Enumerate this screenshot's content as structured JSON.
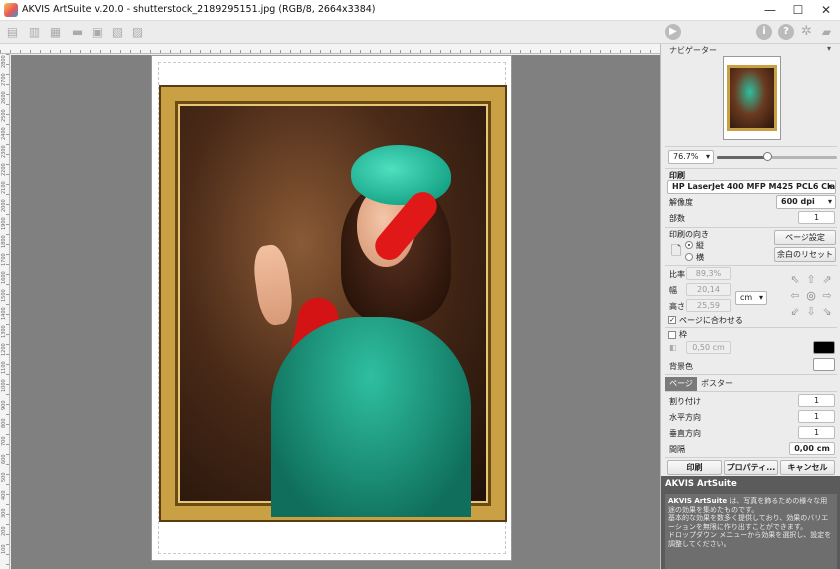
{
  "window": {
    "title": "AKVIS ArtSuite v.20.0 - shutterstock_2189295151.jpg (RGB/8, 2664x3384)",
    "minimize": "—",
    "maximize": "☐",
    "close": "✕"
  },
  "toolbar": {
    "left_icons": [
      "open-icon",
      "save-icon",
      "export-icon",
      "print-icon",
      "batch-icon",
      "preview-icon",
      "share-icon"
    ],
    "right_icons": [
      "run-icon",
      "info-icon",
      "help-icon",
      "settings-icon",
      "notification-icon"
    ],
    "run_glyph": "▶",
    "info_glyph": "i",
    "help_glyph": "?"
  },
  "ruler": {
    "vertical_labels": [
      "2800",
      "2700",
      "2600",
      "2500",
      "2400",
      "2300",
      "2200",
      "2100",
      "2000",
      "1900",
      "1800",
      "1700",
      "1600",
      "1500",
      "1400",
      "1300",
      "1200",
      "1100",
      "1000",
      "900",
      "800",
      "700",
      "600",
      "500",
      "400",
      "300",
      "200",
      "100"
    ]
  },
  "navigator": {
    "title": "ナビゲーター",
    "zoom": "76.7%",
    "zoom_fraction": 0.42
  },
  "print": {
    "section_label": "印刷",
    "printer": "HP LaserJet 400 MFP M425 PCL6 Class Driver",
    "resolution_label": "解像度",
    "resolution_value": "600 dpi",
    "copies_label": "部数",
    "copies_value": "1",
    "orientation_label": "印刷の向き",
    "portrait_label": "縦",
    "landscape_label": "横",
    "page_setup_button": "ページ設定",
    "reset_margins_button": "余白のリセット",
    "scale_label": "比率",
    "scale_value": "89,3%",
    "width_label": "幅",
    "width_value": "20,14",
    "height_label": "高さ",
    "height_value": "25,59",
    "unit": "cm",
    "fit_page_label": "ページに合わせる",
    "fit_page_checked": true,
    "frame_label": "枠",
    "frame_checked": false,
    "frame_width": "0,50 cm",
    "frame_color": "#000000",
    "background_label": "背景色",
    "background_color": "#ffffff"
  },
  "tabs": {
    "page": "ページ",
    "poster": "ポスター"
  },
  "poster": {
    "pages_label": "割り付け",
    "pages_value": "1",
    "horizontal_label": "水平方向",
    "horizontal_value": "1",
    "vertical_label": "垂直方向",
    "vertical_value": "1",
    "gap_label": "間隔",
    "gap_value": "0,00 cm"
  },
  "actions": {
    "print_button": "印刷",
    "properties_button": "プロパティ...",
    "cancel_button": "キャンセル"
  },
  "info": {
    "title": "AKVIS ArtSuite",
    "brand": "AKVIS ArtSuite",
    "line1": "は、写真を飾るための様々な用途の効果を集めたものです。",
    "line2": "基本的な効果を数多く提供しており、効果のバリエーションを無限に作り出すことができます。",
    "line3": "ドロップダウン メニューから効果を選択し、設定を調整してください。"
  },
  "colors": {
    "accent": "#5b5b5b",
    "tab_active": "#7a7a7a"
  }
}
